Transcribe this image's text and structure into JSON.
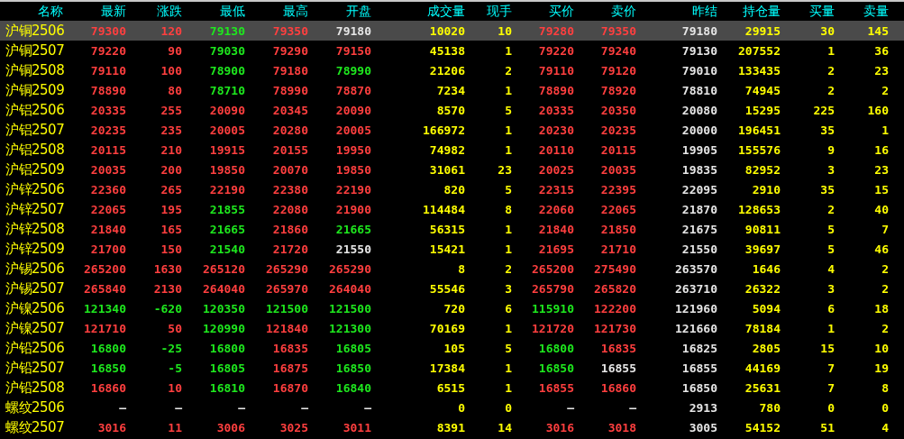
{
  "columns": [
    {
      "label": "名称",
      "kind": "name"
    },
    {
      "label": "最新",
      "kind": "price"
    },
    {
      "label": "涨跌",
      "kind": "price"
    },
    {
      "label": "最低",
      "kind": "price"
    },
    {
      "label": "最高",
      "kind": "price"
    },
    {
      "label": "开盘",
      "kind": "price"
    },
    {
      "label": "成交量",
      "kind": "volume"
    },
    {
      "label": "现手",
      "kind": "volume"
    },
    {
      "label": "买价",
      "kind": "price"
    },
    {
      "label": "卖价",
      "kind": "price"
    },
    {
      "label": "昨结",
      "kind": "settle"
    },
    {
      "label": "持仓量",
      "kind": "volume"
    },
    {
      "label": "买量",
      "kind": "volume"
    },
    {
      "label": "卖量",
      "kind": "volume"
    }
  ],
  "rows": [
    {
      "name": "沪铜2506",
      "selected": true,
      "cells": [
        {
          "text": "79300",
          "color": "#ff3f3f"
        },
        {
          "text": "120",
          "color": "#ff3f3f"
        },
        {
          "text": "79130",
          "color": "#1ee81e"
        },
        {
          "text": "79350",
          "color": "#ff3f3f"
        },
        {
          "text": "79180",
          "color": "#e6e6e6"
        },
        "10020",
        "10",
        {
          "text": "79280",
          "color": "#ff3f3f"
        },
        {
          "text": "79350",
          "color": "#ff3f3f"
        },
        "79180",
        "29915",
        "30",
        "145"
      ]
    },
    {
      "name": "沪铜2507",
      "selected": false,
      "cells": [
        {
          "text": "79220",
          "color": "#ff3f3f"
        },
        {
          "text": "90",
          "color": "#ff3f3f"
        },
        {
          "text": "79030",
          "color": "#1ee81e"
        },
        {
          "text": "79290",
          "color": "#ff3f3f"
        },
        {
          "text": "79150",
          "color": "#ff3f3f"
        },
        "45138",
        "1",
        {
          "text": "79220",
          "color": "#ff3f3f"
        },
        {
          "text": "79240",
          "color": "#ff3f3f"
        },
        "79130",
        "207552",
        "1",
        "36"
      ]
    },
    {
      "name": "沪铜2508",
      "selected": false,
      "cells": [
        {
          "text": "79110",
          "color": "#ff3f3f"
        },
        {
          "text": "100",
          "color": "#ff3f3f"
        },
        {
          "text": "78900",
          "color": "#1ee81e"
        },
        {
          "text": "79180",
          "color": "#ff3f3f"
        },
        {
          "text": "78990",
          "color": "#1ee81e"
        },
        "21206",
        "2",
        {
          "text": "79110",
          "color": "#ff3f3f"
        },
        {
          "text": "79120",
          "color": "#ff3f3f"
        },
        "79010",
        "133435",
        "2",
        "23"
      ]
    },
    {
      "name": "沪铜2509",
      "selected": false,
      "cells": [
        {
          "text": "78890",
          "color": "#ff3f3f"
        },
        {
          "text": "80",
          "color": "#ff3f3f"
        },
        {
          "text": "78710",
          "color": "#1ee81e"
        },
        {
          "text": "78990",
          "color": "#ff3f3f"
        },
        {
          "text": "78870",
          "color": "#ff3f3f"
        },
        "7234",
        "1",
        {
          "text": "78890",
          "color": "#ff3f3f"
        },
        {
          "text": "78920",
          "color": "#ff3f3f"
        },
        "78810",
        "74945",
        "2",
        "2"
      ]
    },
    {
      "name": "沪铝2506",
      "selected": false,
      "cells": [
        {
          "text": "20335",
          "color": "#ff3f3f"
        },
        {
          "text": "255",
          "color": "#ff3f3f"
        },
        {
          "text": "20090",
          "color": "#ff3f3f"
        },
        {
          "text": "20345",
          "color": "#ff3f3f"
        },
        {
          "text": "20090",
          "color": "#ff3f3f"
        },
        "8570",
        "5",
        {
          "text": "20335",
          "color": "#ff3f3f"
        },
        {
          "text": "20350",
          "color": "#ff3f3f"
        },
        "20080",
        "15295",
        "225",
        "160"
      ]
    },
    {
      "name": "沪铝2507",
      "selected": false,
      "cells": [
        {
          "text": "20235",
          "color": "#ff3f3f"
        },
        {
          "text": "235",
          "color": "#ff3f3f"
        },
        {
          "text": "20005",
          "color": "#ff3f3f"
        },
        {
          "text": "20280",
          "color": "#ff3f3f"
        },
        {
          "text": "20005",
          "color": "#ff3f3f"
        },
        "166972",
        "1",
        {
          "text": "20230",
          "color": "#ff3f3f"
        },
        {
          "text": "20235",
          "color": "#ff3f3f"
        },
        "20000",
        "196451",
        "35",
        "1"
      ]
    },
    {
      "name": "沪铝2508",
      "selected": false,
      "cells": [
        {
          "text": "20115",
          "color": "#ff3f3f"
        },
        {
          "text": "210",
          "color": "#ff3f3f"
        },
        {
          "text": "19915",
          "color": "#ff3f3f"
        },
        {
          "text": "20155",
          "color": "#ff3f3f"
        },
        {
          "text": "19950",
          "color": "#ff3f3f"
        },
        "74982",
        "1",
        {
          "text": "20110",
          "color": "#ff3f3f"
        },
        {
          "text": "20115",
          "color": "#ff3f3f"
        },
        "19905",
        "155576",
        "9",
        "16"
      ]
    },
    {
      "name": "沪铝2509",
      "selected": false,
      "cells": [
        {
          "text": "20035",
          "color": "#ff3f3f"
        },
        {
          "text": "200",
          "color": "#ff3f3f"
        },
        {
          "text": "19850",
          "color": "#ff3f3f"
        },
        {
          "text": "20070",
          "color": "#ff3f3f"
        },
        {
          "text": "19850",
          "color": "#ff3f3f"
        },
        "31061",
        "23",
        {
          "text": "20025",
          "color": "#ff3f3f"
        },
        {
          "text": "20035",
          "color": "#ff3f3f"
        },
        "19835",
        "82952",
        "3",
        "23"
      ]
    },
    {
      "name": "沪锌2506",
      "selected": false,
      "cells": [
        {
          "text": "22360",
          "color": "#ff3f3f"
        },
        {
          "text": "265",
          "color": "#ff3f3f"
        },
        {
          "text": "22190",
          "color": "#ff3f3f"
        },
        {
          "text": "22380",
          "color": "#ff3f3f"
        },
        {
          "text": "22190",
          "color": "#ff3f3f"
        },
        "820",
        "5",
        {
          "text": "22315",
          "color": "#ff3f3f"
        },
        {
          "text": "22395",
          "color": "#ff3f3f"
        },
        "22095",
        "2910",
        "35",
        "15"
      ]
    },
    {
      "name": "沪锌2507",
      "selected": false,
      "cells": [
        {
          "text": "22065",
          "color": "#ff3f3f"
        },
        {
          "text": "195",
          "color": "#ff3f3f"
        },
        {
          "text": "21855",
          "color": "#1ee81e"
        },
        {
          "text": "22080",
          "color": "#ff3f3f"
        },
        {
          "text": "21900",
          "color": "#ff3f3f"
        },
        "114484",
        "8",
        {
          "text": "22060",
          "color": "#ff3f3f"
        },
        {
          "text": "22065",
          "color": "#ff3f3f"
        },
        "21870",
        "128653",
        "2",
        "40"
      ]
    },
    {
      "name": "沪锌2508",
      "selected": false,
      "cells": [
        {
          "text": "21840",
          "color": "#ff3f3f"
        },
        {
          "text": "165",
          "color": "#ff3f3f"
        },
        {
          "text": "21665",
          "color": "#1ee81e"
        },
        {
          "text": "21860",
          "color": "#ff3f3f"
        },
        {
          "text": "21665",
          "color": "#1ee81e"
        },
        "56315",
        "1",
        {
          "text": "21840",
          "color": "#ff3f3f"
        },
        {
          "text": "21850",
          "color": "#ff3f3f"
        },
        "21675",
        "90811",
        "5",
        "7"
      ]
    },
    {
      "name": "沪锌2509",
      "selected": false,
      "cells": [
        {
          "text": "21700",
          "color": "#ff3f3f"
        },
        {
          "text": "150",
          "color": "#ff3f3f"
        },
        {
          "text": "21540",
          "color": "#1ee81e"
        },
        {
          "text": "21720",
          "color": "#ff3f3f"
        },
        {
          "text": "21550",
          "color": "#e6e6e6"
        },
        "15421",
        "1",
        {
          "text": "21695",
          "color": "#ff3f3f"
        },
        {
          "text": "21710",
          "color": "#ff3f3f"
        },
        "21550",
        "39697",
        "5",
        "46"
      ]
    },
    {
      "name": "沪锡2506",
      "selected": false,
      "cells": [
        {
          "text": "265200",
          "color": "#ff3f3f"
        },
        {
          "text": "1630",
          "color": "#ff3f3f"
        },
        {
          "text": "265120",
          "color": "#ff3f3f"
        },
        {
          "text": "265290",
          "color": "#ff3f3f"
        },
        {
          "text": "265290",
          "color": "#ff3f3f"
        },
        "8",
        "2",
        {
          "text": "265200",
          "color": "#ff3f3f"
        },
        {
          "text": "275490",
          "color": "#ff3f3f"
        },
        "263570",
        "1646",
        "4",
        "2"
      ]
    },
    {
      "name": "沪锡2507",
      "selected": false,
      "cells": [
        {
          "text": "265840",
          "color": "#ff3f3f"
        },
        {
          "text": "2130",
          "color": "#ff3f3f"
        },
        {
          "text": "264040",
          "color": "#ff3f3f"
        },
        {
          "text": "265970",
          "color": "#ff3f3f"
        },
        {
          "text": "264040",
          "color": "#ff3f3f"
        },
        "55546",
        "3",
        {
          "text": "265790",
          "color": "#ff3f3f"
        },
        {
          "text": "265820",
          "color": "#ff3f3f"
        },
        "263710",
        "26322",
        "3",
        "2"
      ]
    },
    {
      "name": "沪镍2506",
      "selected": false,
      "cells": [
        {
          "text": "121340",
          "color": "#1ee81e"
        },
        {
          "text": "-620",
          "color": "#1ee81e"
        },
        {
          "text": "120350",
          "color": "#1ee81e"
        },
        {
          "text": "121500",
          "color": "#1ee81e"
        },
        {
          "text": "121500",
          "color": "#1ee81e"
        },
        "720",
        "6",
        {
          "text": "115910",
          "color": "#1ee81e"
        },
        {
          "text": "122200",
          "color": "#ff3f3f"
        },
        "121960",
        "5094",
        "6",
        "18"
      ]
    },
    {
      "name": "沪镍2507",
      "selected": false,
      "cells": [
        {
          "text": "121710",
          "color": "#ff3f3f"
        },
        {
          "text": "50",
          "color": "#ff3f3f"
        },
        {
          "text": "120990",
          "color": "#1ee81e"
        },
        {
          "text": "121840",
          "color": "#ff3f3f"
        },
        {
          "text": "121300",
          "color": "#1ee81e"
        },
        "70169",
        "1",
        {
          "text": "121720",
          "color": "#ff3f3f"
        },
        {
          "text": "121730",
          "color": "#ff3f3f"
        },
        "121660",
        "78184",
        "1",
        "2"
      ]
    },
    {
      "name": "沪铅2506",
      "selected": false,
      "cells": [
        {
          "text": "16800",
          "color": "#1ee81e"
        },
        {
          "text": "-25",
          "color": "#1ee81e"
        },
        {
          "text": "16800",
          "color": "#1ee81e"
        },
        {
          "text": "16835",
          "color": "#ff3f3f"
        },
        {
          "text": "16805",
          "color": "#1ee81e"
        },
        "105",
        "5",
        {
          "text": "16800",
          "color": "#1ee81e"
        },
        {
          "text": "16835",
          "color": "#ff3f3f"
        },
        "16825",
        "2805",
        "15",
        "10"
      ]
    },
    {
      "name": "沪铅2507",
      "selected": false,
      "cells": [
        {
          "text": "16850",
          "color": "#1ee81e"
        },
        {
          "text": "-5",
          "color": "#1ee81e"
        },
        {
          "text": "16805",
          "color": "#1ee81e"
        },
        {
          "text": "16875",
          "color": "#ff3f3f"
        },
        {
          "text": "16850",
          "color": "#1ee81e"
        },
        "17384",
        "1",
        {
          "text": "16850",
          "color": "#1ee81e"
        },
        {
          "text": "16855",
          "color": "#e6e6e6"
        },
        "16855",
        "44169",
        "7",
        "19"
      ]
    },
    {
      "name": "沪铅2508",
      "selected": false,
      "cells": [
        {
          "text": "16860",
          "color": "#ff3f3f"
        },
        {
          "text": "10",
          "color": "#ff3f3f"
        },
        {
          "text": "16810",
          "color": "#1ee81e"
        },
        {
          "text": "16870",
          "color": "#ff3f3f"
        },
        {
          "text": "16840",
          "color": "#1ee81e"
        },
        "6515",
        "1",
        {
          "text": "16855",
          "color": "#ff3f3f"
        },
        {
          "text": "16860",
          "color": "#ff3f3f"
        },
        "16850",
        "25631",
        "7",
        "8"
      ]
    },
    {
      "name": "螺纹2506",
      "selected": false,
      "cells": [
        {
          "text": "—",
          "color": "#e6e6e6"
        },
        {
          "text": "—",
          "color": "#e6e6e6"
        },
        {
          "text": "—",
          "color": "#e6e6e6"
        },
        {
          "text": "—",
          "color": "#e6e6e6"
        },
        {
          "text": "—",
          "color": "#e6e6e6"
        },
        "0",
        "0",
        {
          "text": "—",
          "color": "#e6e6e6"
        },
        {
          "text": "—",
          "color": "#e6e6e6"
        },
        "2913",
        "780",
        "0",
        "0"
      ]
    },
    {
      "name": "螺纹2507",
      "selected": false,
      "cells": [
        {
          "text": "3016",
          "color": "#ff3f3f"
        },
        {
          "text": "11",
          "color": "#ff3f3f"
        },
        {
          "text": "3006",
          "color": "#ff3f3f"
        },
        {
          "text": "3025",
          "color": "#ff3f3f"
        },
        {
          "text": "3011",
          "color": "#ff3f3f"
        },
        "8391",
        "14",
        {
          "text": "3016",
          "color": "#ff3f3f"
        },
        {
          "text": "3018",
          "color": "#ff3f3f"
        },
        "3005",
        "54152",
        "51",
        "4"
      ]
    }
  ]
}
